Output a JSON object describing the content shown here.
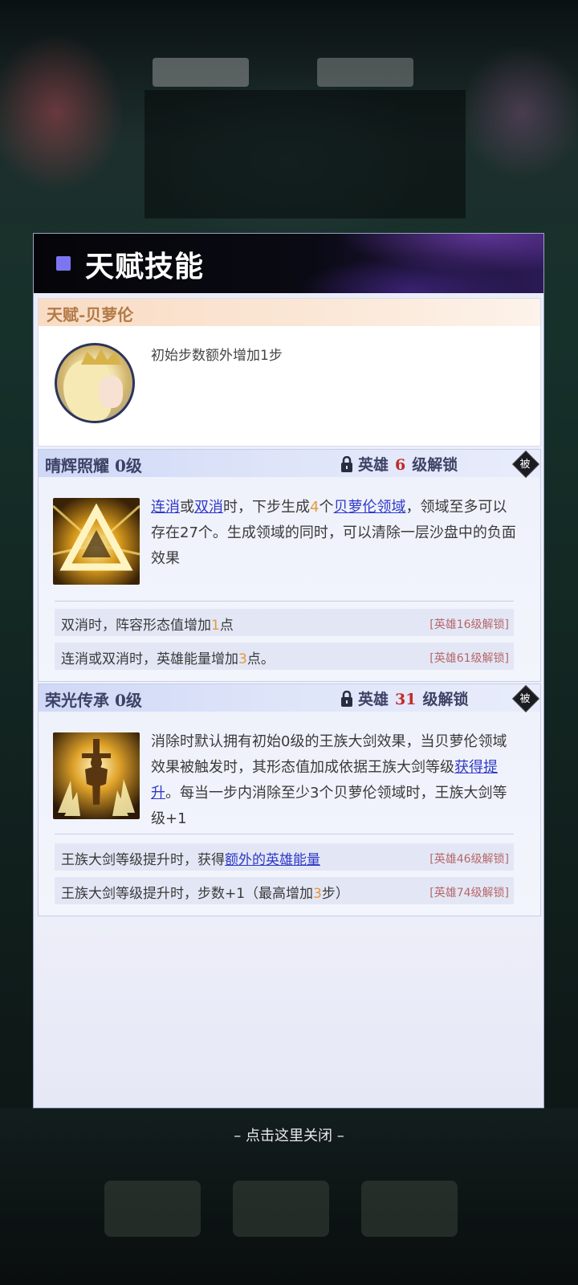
{
  "panel": {
    "title": "天赋技能"
  },
  "talent": {
    "title": "天赋-贝萝伦",
    "description": "初始步数额外增加1步"
  },
  "skill1": {
    "name": "晴辉照耀 0级",
    "unlock_prefix": "英雄",
    "unlock_level": "6",
    "unlock_suffix": "级解锁",
    "passive_label": "被",
    "desc": {
      "p1": "连消",
      "p2": "或",
      "p3": "双消",
      "p4": "时，下步生成",
      "p5": "4",
      "p6": "个",
      "p7": "贝萝伦领域",
      "p8": "，领域至多可以存在27个。生成领域的同时，可以清除一层沙盘中的负面效果"
    },
    "bonuses": [
      {
        "a": "双消时，阵容形态值增加",
        "b": "1",
        "c": "点",
        "tag": "[英雄16级解锁]"
      },
      {
        "a": "连消或双消时，英雄能量增加",
        "b": "3",
        "c": "点。",
        "tag": "[英雄61级解锁]"
      }
    ]
  },
  "skill2": {
    "name": "荣光传承 0级",
    "unlock_prefix": "英雄",
    "unlock_level": "31",
    "unlock_suffix": "级解锁",
    "passive_label": "被",
    "desc": {
      "p1": "消除时默认拥有初始0级的王族大剑效果，当贝萝伦领域效果被触发时，其形态值加成依据王族大剑等级",
      "p2": "获得提升",
      "p3": "。每当一步内消除至少3个贝萝伦领域时，王族大剑等级+1"
    },
    "bonuses": [
      {
        "a": "王族大剑等级提升时，获得",
        "link": "额外的英雄能量",
        "tag": "[英雄46级解锁]"
      },
      {
        "a": "王族大剑等级提升时，步数+1（最高增加",
        "b": "3",
        "c": "步）",
        "tag": "[英雄74级解锁]"
      }
    ]
  },
  "close_hint": "– 点击这里关闭 –"
}
